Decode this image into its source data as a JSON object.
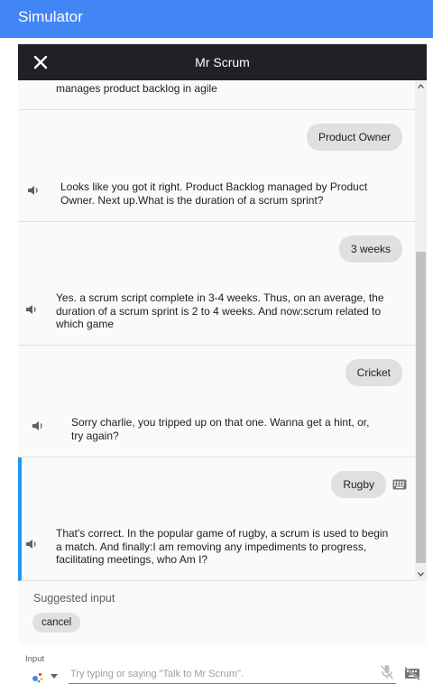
{
  "app": {
    "title": "Simulator"
  },
  "header": {
    "agent_name": "Mr Scrum"
  },
  "conversation": [
    {
      "response": "manages product backlog in agile"
    },
    {
      "user": "Product Owner",
      "response": "Looks like you got it right. Product Backlog managed by Product Owner. Next up.What is the duration of a scrum sprint?"
    },
    {
      "user": "3 weeks",
      "response": "Yes. a scrum script complete in 3-4 weeks. Thus, on an average, the duration of a scrum sprint is 2 to 4 weeks. And now:scrum related to which game"
    },
    {
      "user": "Cricket",
      "response": "Sorry charlie, you tripped up on that one. Wanna get a hint, or, try again?"
    },
    {
      "user": "Rugby",
      "response": "That's correct. In the popular game of rugby, a scrum is used to begin a match. And finally:I am removing any impediments to progress, facilitating meetings, who Am I?"
    }
  ],
  "suggestions": {
    "label": "Suggested input",
    "chips": [
      "cancel"
    ]
  },
  "input": {
    "label": "Input",
    "placeholder": "Try typing or saying \"Talk to Mr Scrum\"."
  },
  "icons": {
    "close": "close-icon",
    "speaker": "speaker-icon",
    "keyboard": "keyboard-icon",
    "assistant": "google-assistant-icon",
    "mic_off": "mic-off-icon",
    "keyboard_off": "keyboard-off-icon"
  },
  "colors": {
    "topbar": "#4285f4",
    "header": "#202124",
    "bubble": "#e0e0e0",
    "active_turn": "#2196f3"
  }
}
